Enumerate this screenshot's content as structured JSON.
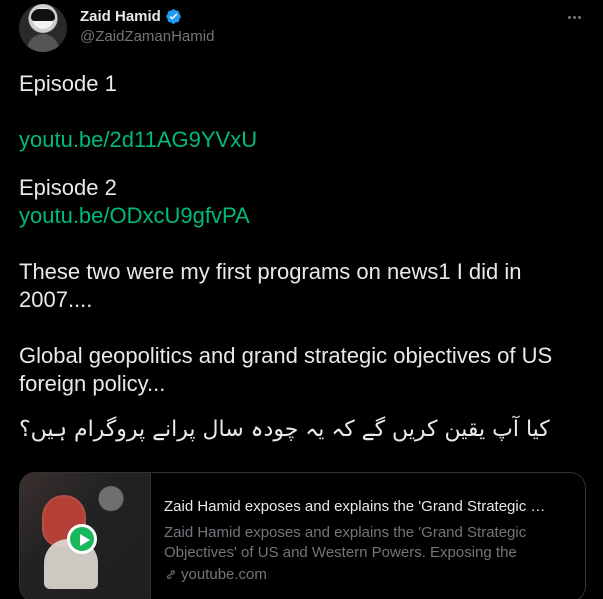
{
  "author": {
    "display_name": "Zaid Hamid",
    "handle": "@ZaidZamanHamid",
    "verified_icon": "verified-badge-icon"
  },
  "post": {
    "episode1_label": "Episode 1",
    "episode1_link": "youtu.be/2d11AG9YVxU",
    "episode2_label": "Episode 2",
    "episode2_link": "youtu.be/ODxcU9gfvPA",
    "line1": "These two were my first programs on news1 I did in",
    "line2": "2007....",
    "line3": "Global geopolitics and grand strategic objectives of US",
    "line4": "foreign policy...",
    "urdu_text": "کیا آپ یقین کریں گے کہ یہ چودہ سال پرانے پروگرام ہیں؟"
  },
  "card": {
    "title": "Zaid Hamid exposes and explains the 'Grand Strategic Obje...",
    "description": "Zaid Hamid exposes and explains the 'Grand Strategic Objectives' of US and Western Powers. Exposing the reality o...",
    "domain": "youtube.com",
    "play_icon": "play-icon",
    "link_icon": "link-icon"
  },
  "colors": {
    "background": "#000000",
    "text": "#e7e9ea",
    "muted": "#71767b",
    "link": "#00ba7c",
    "border": "#2f3336",
    "verified": "#1d9bf0"
  }
}
